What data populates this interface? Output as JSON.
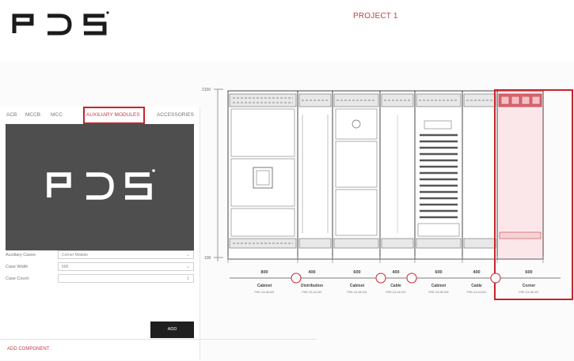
{
  "brand": {
    "logo_text": "PDS"
  },
  "header": {
    "project_title": "PROJECT 1",
    "accent": "#c43b48"
  },
  "tabs": [
    {
      "label": "ACB"
    },
    {
      "label": "MCCB"
    },
    {
      "label": "MCC"
    },
    {
      "label": "AUXILIARY MODULES",
      "active": true
    },
    {
      "label": "ACCESSORIES"
    }
  ],
  "form": {
    "aux_cases": {
      "label": "Auxiliary Cases",
      "value": "Corner Module"
    },
    "case_width": {
      "label": "Case Width",
      "value": "600"
    },
    "case_count": {
      "label": "Case Count",
      "value": "1"
    },
    "add_label": "ADD"
  },
  "footer": {
    "add_component": "ADD COMPONENT"
  },
  "diagram": {
    "height_top": "2100",
    "height_bottom": "100",
    "cabinets": [
      {
        "width": "800",
        "name": "Cabinet",
        "code": "PHE-CA-08-021"
      },
      {
        "width": "400",
        "name": "Distribution",
        "code": "PHE-CA-04-007"
      },
      {
        "width": "600",
        "name": "Cabinet",
        "code": "PHE-CA-06-021"
      },
      {
        "width": "400",
        "name": "Cable",
        "code": "PHE-CA-04-010"
      },
      {
        "width": "600",
        "name": "Cabinet",
        "code": "PHE-CA-06-004"
      },
      {
        "width": "400",
        "name": "Cable",
        "code": "PHE-CA-04-011"
      },
      {
        "width": "600",
        "name": "Corner",
        "code": "PHE-CA-06-027"
      }
    ]
  }
}
